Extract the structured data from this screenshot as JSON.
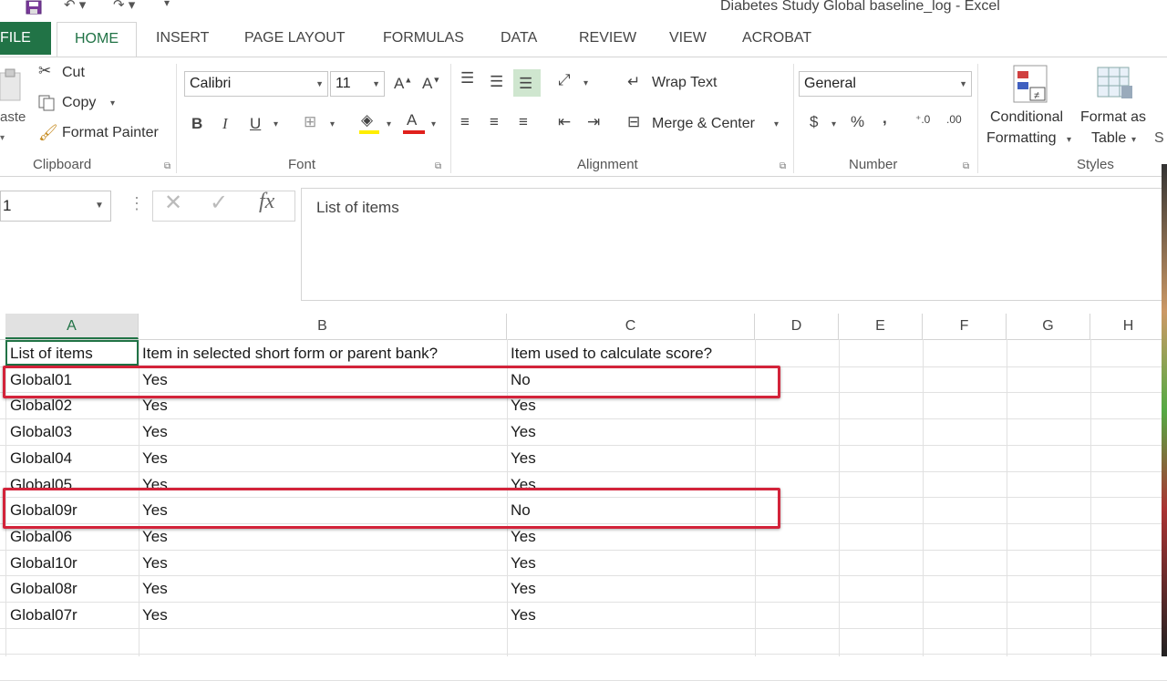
{
  "window": {
    "title": "Diabetes Study Global baseline_log - Excel"
  },
  "tabs": [
    "FILE",
    "HOME",
    "INSERT",
    "PAGE LAYOUT",
    "FORMULAS",
    "DATA",
    "REVIEW",
    "VIEW",
    "ACROBAT"
  ],
  "ribbon": {
    "clipboard": {
      "paste_label": "aste",
      "cut_label": "Cut",
      "copy_label": "Copy",
      "format_painter_label": "Format Painter",
      "group_label": "Clipboard"
    },
    "font": {
      "font_name": "Calibri",
      "font_size": "11",
      "bold": "B",
      "italic": "I",
      "underline": "U",
      "group_label": "Font"
    },
    "alignment": {
      "wrap_text_label": "Wrap Text",
      "merge_center_label": "Merge & Center",
      "group_label": "Alignment"
    },
    "number": {
      "format": "General",
      "currency": "$",
      "percent": "%",
      "comma": ",",
      "group_label": "Number"
    },
    "styles": {
      "conditional_line1": "Conditional",
      "conditional_line2": "Formatting",
      "format_table_line1": "Format as",
      "format_table_line2": "Table",
      "group_label": "Styles"
    }
  },
  "formula_bar": {
    "name_box": "1",
    "fx": "fx",
    "content": "List of items"
  },
  "grid": {
    "columns": [
      "A",
      "B",
      "C",
      "D",
      "E",
      "F",
      "G",
      "H"
    ],
    "rows": [
      [
        "List of items",
        "Item in selected short form or parent bank?",
        "Item used to calculate score?"
      ],
      [
        "Global01",
        "Yes",
        "No"
      ],
      [
        "Global02",
        "Yes",
        "Yes"
      ],
      [
        "Global03",
        "Yes",
        "Yes"
      ],
      [
        "Global04",
        "Yes",
        "Yes"
      ],
      [
        "Global05",
        "Yes",
        "Yes"
      ],
      [
        "Global09r",
        "Yes",
        "No"
      ],
      [
        "Global06",
        "Yes",
        "Yes"
      ],
      [
        "Global10r",
        "Yes",
        "Yes"
      ],
      [
        "Global08r",
        "Yes",
        "Yes"
      ],
      [
        "Global07r",
        "Yes",
        "Yes"
      ]
    ]
  },
  "colors": {
    "accent": "#217346",
    "highlight_box": "#d3233a",
    "fill_color_bar": "#ffee00",
    "font_color_bar": "#e0201c"
  }
}
